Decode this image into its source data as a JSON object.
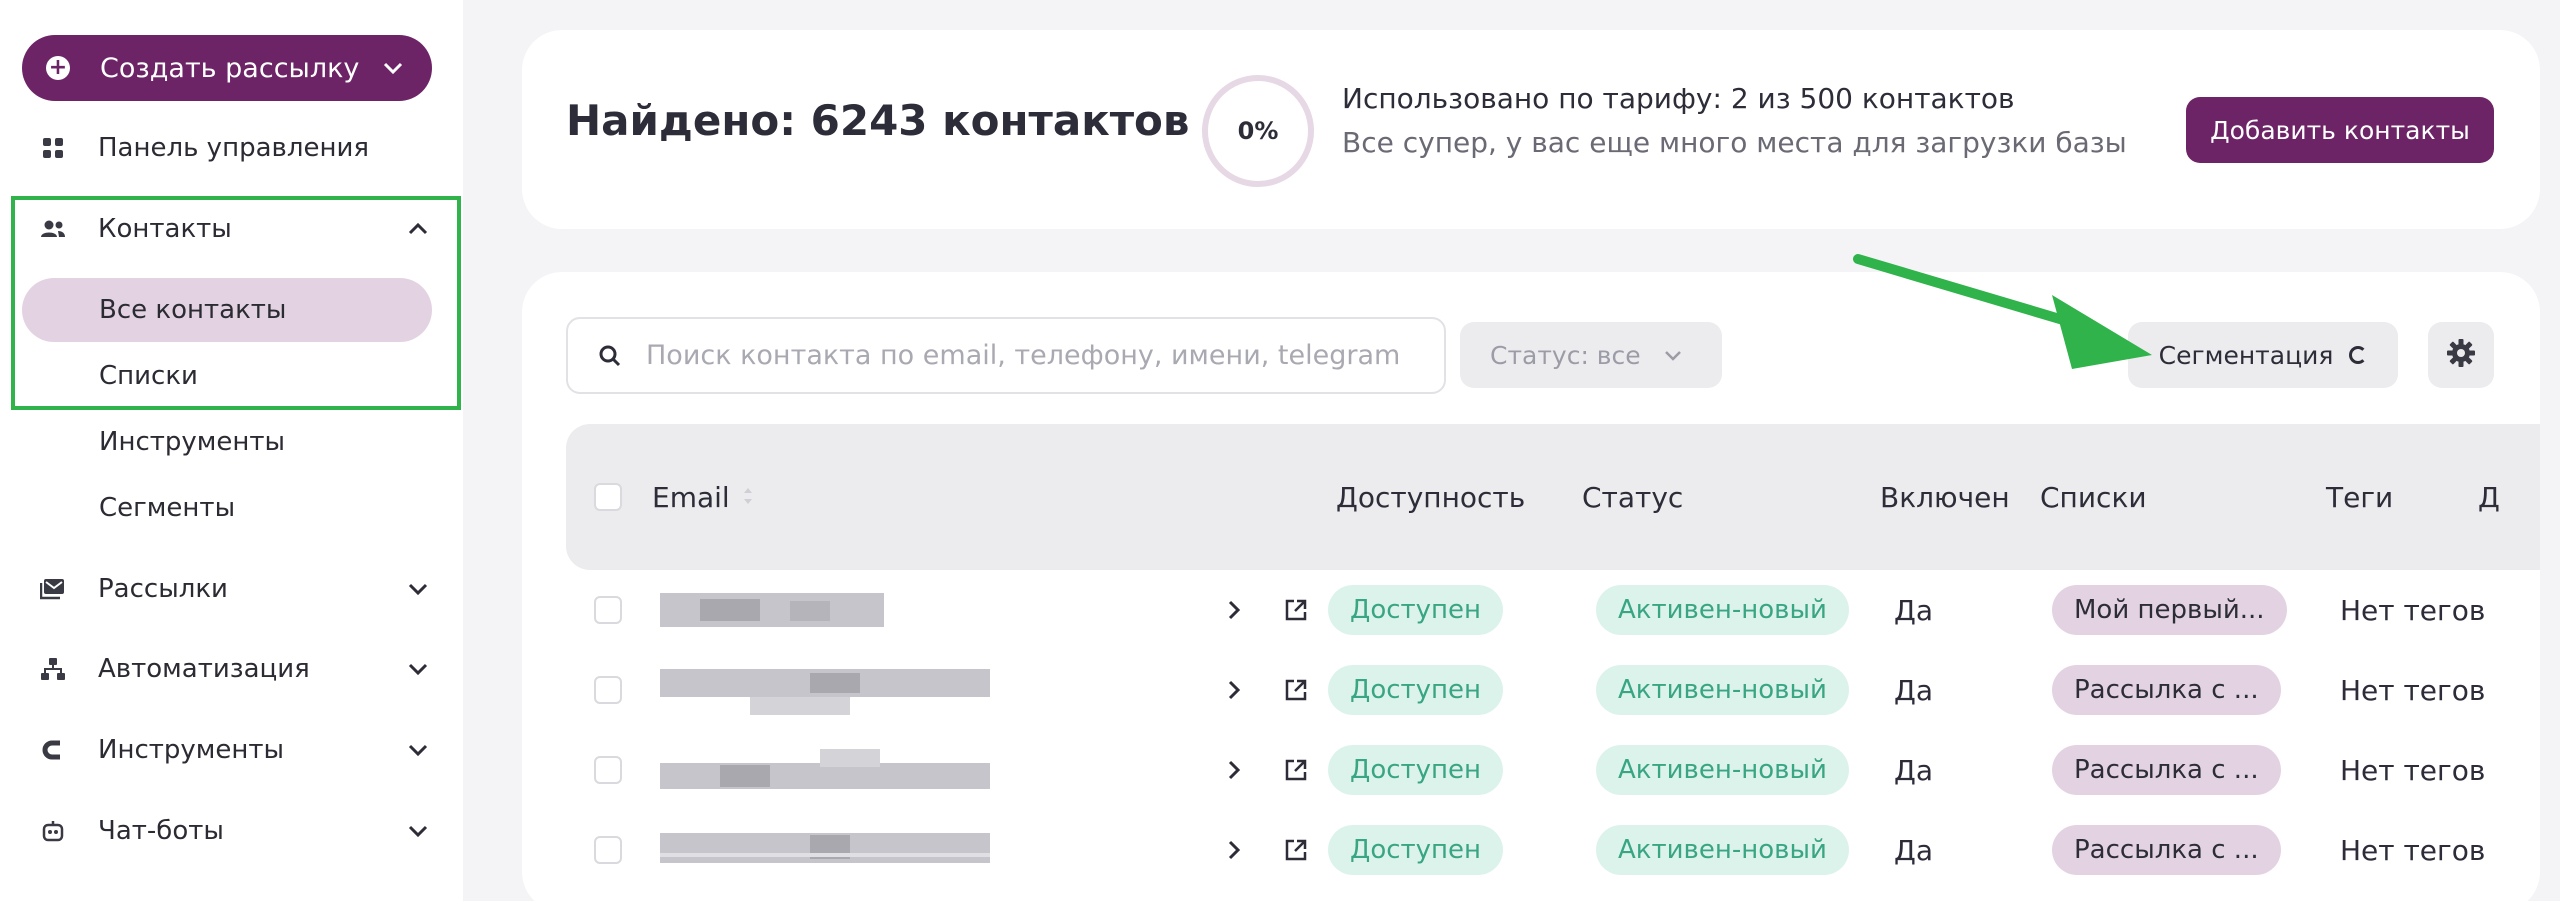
{
  "sidebar": {
    "create_button": "Создать рассылку",
    "items": [
      {
        "label": "Панель управления",
        "icon": "grid-icon"
      },
      {
        "label": "Контакты",
        "icon": "users-icon",
        "expanded": true
      },
      {
        "label": "Рассылки",
        "icon": "mail-icon"
      },
      {
        "label": "Автоматизация",
        "icon": "flow-icon"
      },
      {
        "label": "Инструменты",
        "icon": "magnet-icon"
      },
      {
        "label": "Чат-боты",
        "icon": "bot-icon"
      }
    ],
    "contacts_sub": [
      "Все контакты",
      "Списки",
      "Инструменты",
      "Сегменты"
    ]
  },
  "header": {
    "found": "Найдено: 6243 контактов",
    "usage_percent": "0%",
    "usage_title": "Использовано по тарифу: 2 из 500 контактов",
    "usage_sub": "Все супер, у вас еще много места для загрузки базы",
    "add_button": "Добавить контакты"
  },
  "toolbar": {
    "search_placeholder": "Поиск контакта по email, телефону, имени, telegram",
    "status_filter": "Статус: все",
    "segmentation": "Сегментация"
  },
  "table": {
    "columns": [
      "Email",
      "Доступность",
      "Статус",
      "Включен",
      "Списки",
      "Теги",
      "Д"
    ],
    "rows": [
      {
        "availability": "Доступен",
        "status": "Активен-новый",
        "enabled": "Да",
        "list": "Мой первый...",
        "tags": "Нет тегов"
      },
      {
        "availability": "Доступен",
        "status": "Активен-новый",
        "enabled": "Да",
        "list": "Рассылка с ...",
        "tags": "Нет тегов"
      },
      {
        "availability": "Доступен",
        "status": "Активен-новый",
        "enabled": "Да",
        "list": "Рассылка с ...",
        "tags": "Нет тегов"
      },
      {
        "availability": "Доступен",
        "status": "Активен-новый",
        "enabled": "Да",
        "list": "Рассылка с ...",
        "tags": "Нет тегов"
      }
    ]
  },
  "colors": {
    "brand": "#6d2466",
    "highlight": "#2fb34a",
    "available": "#3aa583"
  }
}
